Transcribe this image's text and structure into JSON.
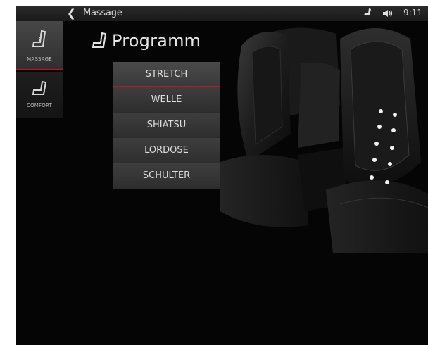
{
  "statusbar": {
    "title": "Massage",
    "time": "9:11",
    "back_icon": "chevron-left-icon",
    "seat_icon": "seat-icon",
    "volume_icon": "speaker-icon"
  },
  "sidebar": {
    "tabs": [
      {
        "label": "MASSAGE",
        "icon": "massage-seat-icon",
        "active": true
      },
      {
        "label": "COMFORT",
        "icon": "comfort-seat-icon",
        "active": false
      }
    ]
  },
  "main": {
    "title": "Programm",
    "title_icon": "massage-seat-icon",
    "menu": [
      {
        "label": "STRETCH",
        "selected": true
      },
      {
        "label": "WELLE",
        "selected": false
      },
      {
        "label": "SHIATSU",
        "selected": false
      },
      {
        "label": "LORDOSE",
        "selected": false
      },
      {
        "label": "SCHULTER",
        "selected": false
      }
    ]
  },
  "colors": {
    "accent": "#c8102e",
    "background": "#050505",
    "menu_bg": "#363636",
    "text": "#e0e0e0"
  }
}
